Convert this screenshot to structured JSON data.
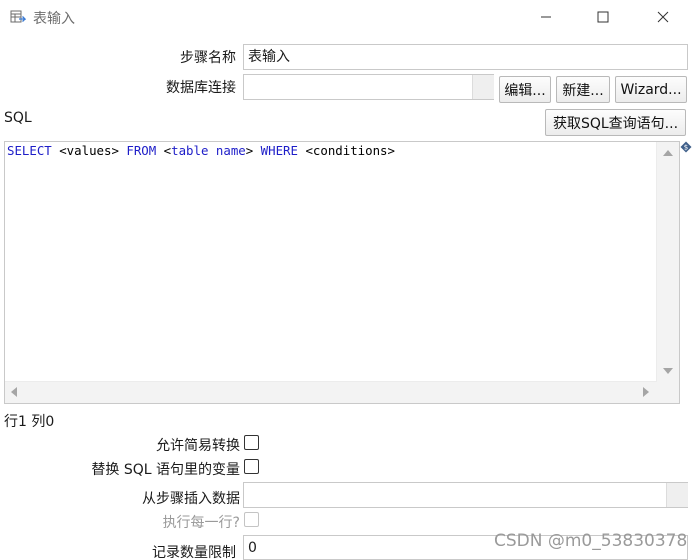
{
  "window": {
    "title": "表输入",
    "controls": {
      "minimize": "minimize-icon",
      "maximize": "maximize-icon",
      "close": "close-icon"
    }
  },
  "form": {
    "step_name_label": "步骤名称",
    "step_name_value": "表输入",
    "db_connection_label": "数据库连接",
    "db_connection_value": "",
    "edit_button": "编辑...",
    "new_button": "新建...",
    "wizard_button": "Wizard...",
    "sql_label": "SQL",
    "get_sql_button": "获取SQL查询语句..."
  },
  "editor": {
    "tokens": [
      {
        "text": "SELECT",
        "kw": true
      },
      {
        "text": " <values> ",
        "kw": false
      },
      {
        "text": "FROM",
        "kw": true
      },
      {
        "text": " <",
        "kw": false
      },
      {
        "text": "table name",
        "kw": true
      },
      {
        "text": "> ",
        "kw": false
      },
      {
        "text": "WHERE",
        "kw": true
      },
      {
        "text": " <conditions>",
        "kw": false
      }
    ]
  },
  "status": {
    "position": "行1 列0"
  },
  "options": {
    "lazy_conversion_label": "允许简易转换",
    "lazy_conversion_checked": false,
    "replace_vars_label": "替换 SQL 语句里的变量",
    "replace_vars_checked": false,
    "insert_from_step_label": "从步骤插入数据",
    "insert_from_step_value": "",
    "execute_each_row_label": "执行每一行?",
    "execute_each_row_checked": false,
    "limit_label": "记录数量限制",
    "limit_value": "0"
  },
  "watermark": "CSDN @m0_53830378",
  "colors": {
    "keyword": "#1d1dc8",
    "border": "#c9c9c9",
    "disabled_text": "#9a9a9a"
  }
}
